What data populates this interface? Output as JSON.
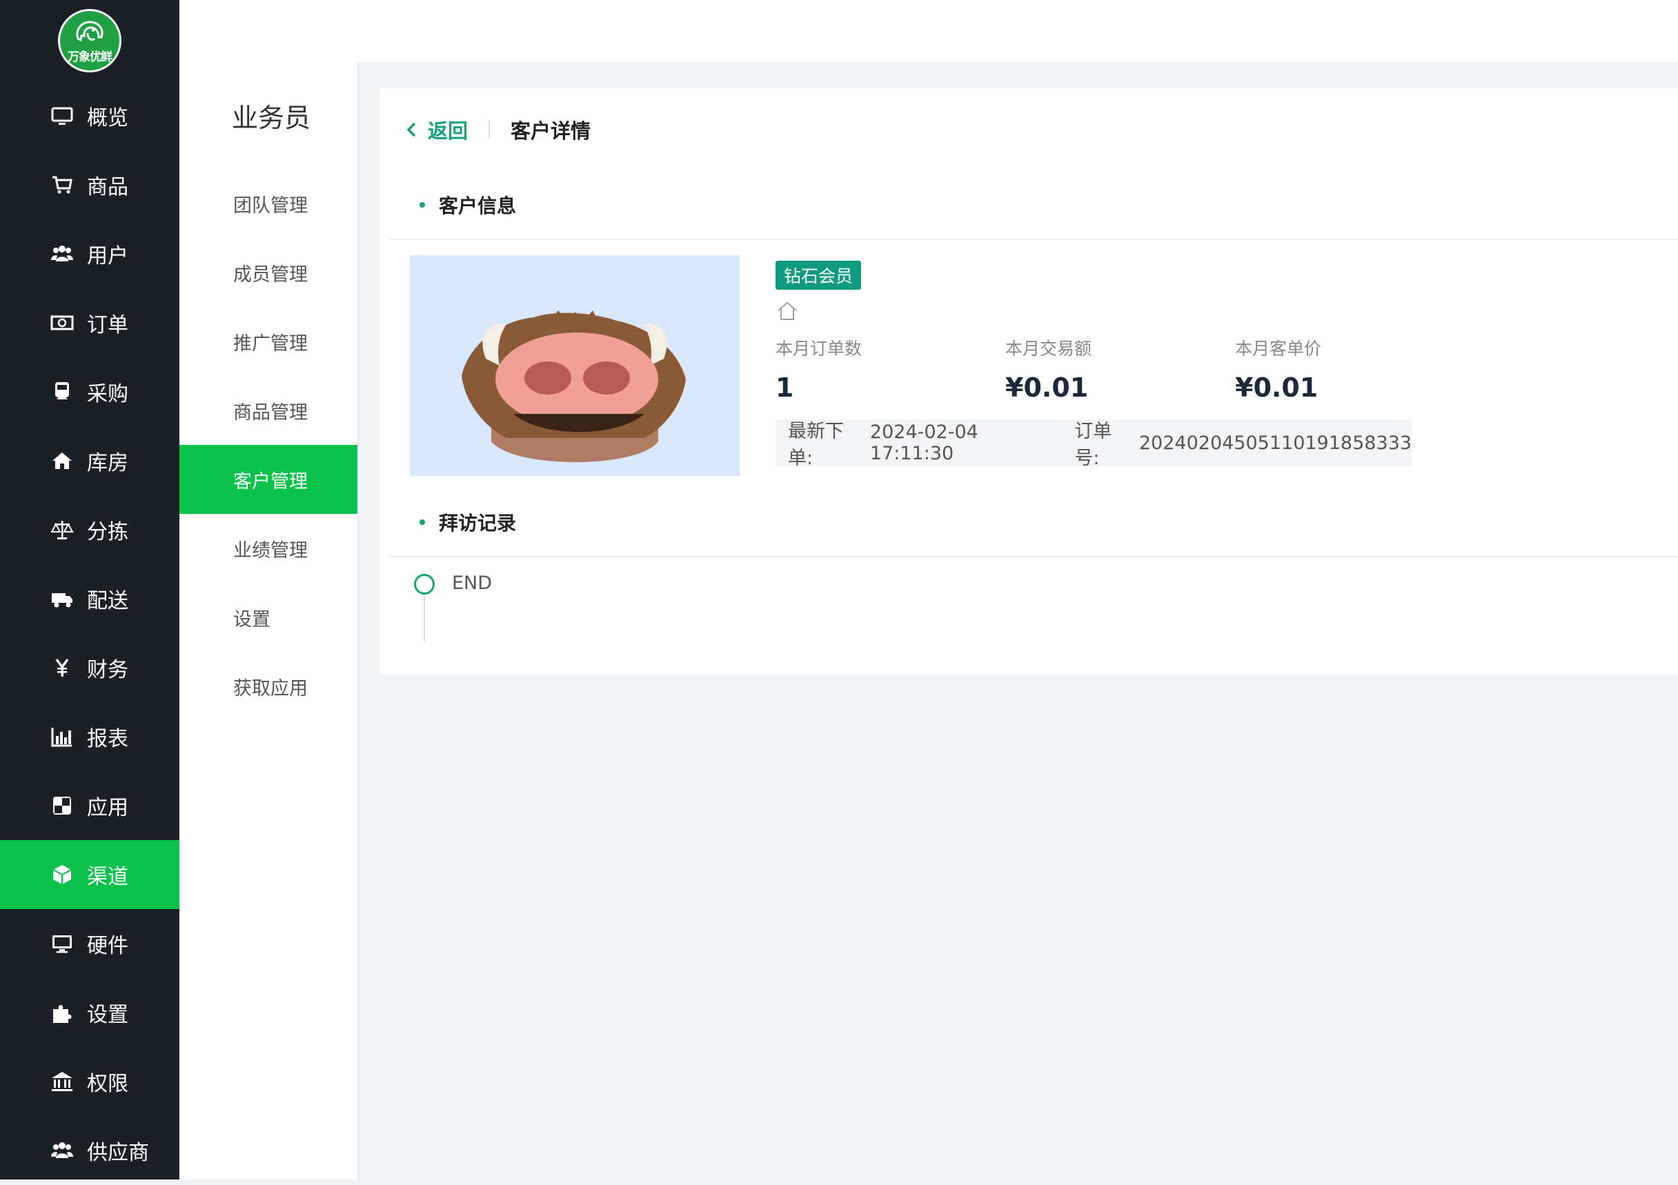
{
  "brand": {
    "logo_text": "万象优鲜",
    "accent": "#08c24a",
    "link_color": "#14a37f"
  },
  "sidebar": {
    "items": [
      {
        "label": "概览",
        "icon": "monitor-icon"
      },
      {
        "label": "商品",
        "icon": "cart-icon"
      },
      {
        "label": "用户",
        "icon": "users-icon"
      },
      {
        "label": "订单",
        "icon": "cash-icon"
      },
      {
        "label": "采购",
        "icon": "train-icon"
      },
      {
        "label": "库房",
        "icon": "home-icon"
      },
      {
        "label": "分拣",
        "icon": "scale-icon"
      },
      {
        "label": "配送",
        "icon": "truck-icon"
      },
      {
        "label": "财务",
        "icon": "yen-icon"
      },
      {
        "label": "报表",
        "icon": "bar-chart-icon"
      },
      {
        "label": "应用",
        "icon": "app-icon"
      },
      {
        "label": "渠道",
        "icon": "cube-icon",
        "active": true
      },
      {
        "label": "硬件",
        "icon": "desktop-icon"
      },
      {
        "label": "设置",
        "icon": "puzzle-icon"
      },
      {
        "label": "权限",
        "icon": "bank-icon"
      },
      {
        "label": "供应商",
        "icon": "users-icon"
      }
    ]
  },
  "subnav": {
    "title": "业务员",
    "items": [
      {
        "label": "团队管理"
      },
      {
        "label": "成员管理"
      },
      {
        "label": "推广管理"
      },
      {
        "label": "商品管理"
      },
      {
        "label": "客户管理",
        "active": true
      },
      {
        "label": "业绩管理"
      },
      {
        "label": "设置"
      },
      {
        "label": "获取应用"
      }
    ]
  },
  "header": {
    "back_label": "返回",
    "title": "客户详情"
  },
  "customer": {
    "section_title": "客户信息",
    "badge": "钻石会员",
    "stats": [
      {
        "label": "本月订单数",
        "value": "1"
      },
      {
        "label": "本月交易额",
        "value": "¥0.01"
      },
      {
        "label": "本月客单价",
        "value": "¥0.01"
      }
    ],
    "latest_order_label": "最新下单:",
    "latest_order_time": "2024-02-04 17:11:30",
    "order_no_label": "订单号:",
    "order_no": "20240204505110191858333"
  },
  "visits": {
    "section_title": "拜访记录",
    "end_label": "END"
  }
}
